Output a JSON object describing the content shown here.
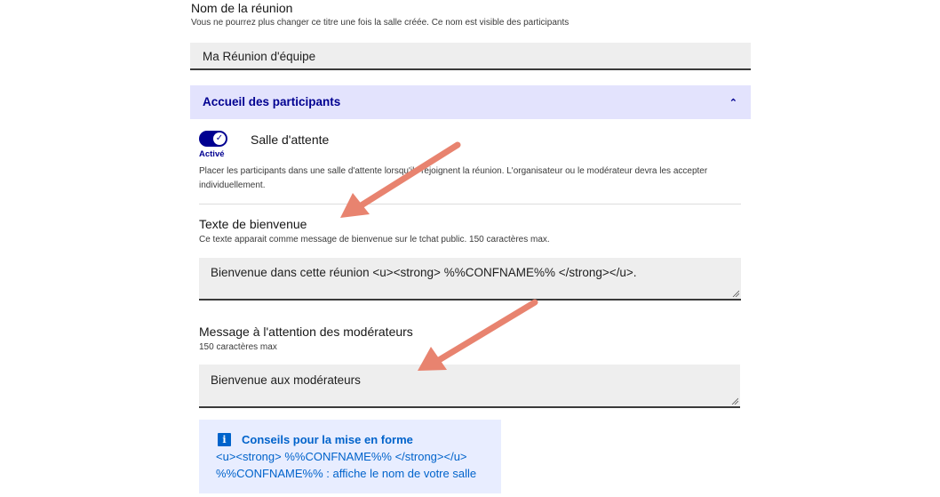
{
  "meeting_name": {
    "label": "Nom de la réunion",
    "hint": "Vous ne pourrez plus changer ce titre une fois la salle créée. Ce nom est visible des participants",
    "value": "Ma Réunion d'équipe"
  },
  "accordion": {
    "title": "Accueil des participants",
    "chevron": "⌃"
  },
  "waiting_room": {
    "label": "Salle d'attente",
    "state_label": "Activé",
    "enabled": true,
    "description_line1": "Placer les participants dans une salle d'attente lorsqu'ils rejoignent la réunion. L'organisateur ou le modérateur devra les accepter",
    "description_line2": "individuellement."
  },
  "welcome_text": {
    "label": "Texte de bienvenue",
    "hint": "Ce texte apparait comme message de bienvenue sur le tchat public. 150 caractères max.",
    "value": "Bienvenue dans cette réunion <u><strong> %%CONFNAME%% </strong></u>."
  },
  "moderator_message": {
    "label": "Message à l'attention des modérateurs",
    "hint": "150 caractères max",
    "value": "Bienvenue aux modérateurs"
  },
  "formatting_tips": {
    "icon": "info-icon",
    "title": "Conseils pour la mise en forme",
    "line1": "<u><strong> %%CONFNAME%% </strong></u>",
    "line2": "%%CONFNAME%% : affiche le nom de votre salle"
  },
  "colors": {
    "primary": "#000091",
    "accordion_bg": "#e3e3fd",
    "input_bg": "#eeeeee",
    "callout_bg": "#e8edff",
    "callout_text": "#0063cb",
    "annotation_arrow": "#e8836f"
  }
}
